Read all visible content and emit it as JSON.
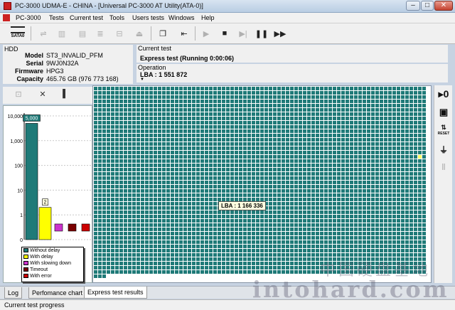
{
  "window": {
    "title": "PC-3000 UDMA-E - CHINA - [Universal PC-3000 AT Utility(ATA-0)]",
    "controls": [
      "–",
      "□",
      "✕"
    ]
  },
  "menu": [
    "PC-3000",
    "Tests",
    "Current test",
    "Tools",
    "Users tests",
    "Windows",
    "Help"
  ],
  "toolbar": {
    "sata_label": "SATA0",
    "buttons": [
      "usb-connect-icon",
      "chip-icon",
      "columns-icon",
      "disk-stack-icon",
      "save-icon",
      "windows-icon",
      "exit-icon",
      "play-icon",
      "stop-icon",
      "step-icon",
      "pause-icon",
      "fast-forward-icon"
    ]
  },
  "hdd": {
    "legend": "HDD",
    "model_label": "Model",
    "model": "ST3_INVALID_PFM",
    "serial_label": "Serial",
    "serial": "9WJ0N32A",
    "firmware_label": "Firmware",
    "firmware": "HPG3",
    "capacity_label": "Capacity",
    "capacity": "465.76 GB (976 773 168)"
  },
  "current_test": {
    "caption": "Current test",
    "value": "Express test (Running 0:00:06)"
  },
  "operation": {
    "caption": "Operation",
    "lba": "LBA : 1 551 872"
  },
  "chart_data": {
    "type": "bar",
    "scale": "log",
    "y_ticks": [
      "10,000",
      "1,000",
      "100",
      "10",
      "1",
      "0"
    ],
    "categories": [
      "Without delay",
      "With delay",
      "With slowing down",
      "Timeout",
      "With error"
    ],
    "values": [
      5000,
      2,
      0,
      0,
      0
    ],
    "data_labels": [
      "5,000",
      "2",
      "",
      "",
      ""
    ],
    "colors": [
      "#1f7a78",
      "#ffff00",
      "#cc33cc",
      "#7a0000",
      "#cc0000"
    ]
  },
  "legend": [
    "Without delay",
    "With delay",
    "With slowing down",
    "Timeout",
    "With error"
  ],
  "map": {
    "tooltip": "LBA : 1 166 336",
    "cell_color": "#1f7a78",
    "highlight_color": "#ffff66"
  },
  "right_tools": [
    {
      "icon": "zero-fill-icon",
      "label": "0"
    },
    {
      "icon": "drive-info-icon",
      "label": ""
    },
    {
      "icon": "reset-icon",
      "label": "RESET"
    },
    {
      "icon": "power-icon",
      "label": ""
    },
    {
      "icon": "power-off-icon",
      "label": ""
    }
  ],
  "tabs": [
    "Log",
    "Perfomance chart",
    "Express test results"
  ],
  "status": "Current test progress",
  "watermark": {
    "cn": "中国硬盘基地",
    "en": "intohard.com"
  }
}
